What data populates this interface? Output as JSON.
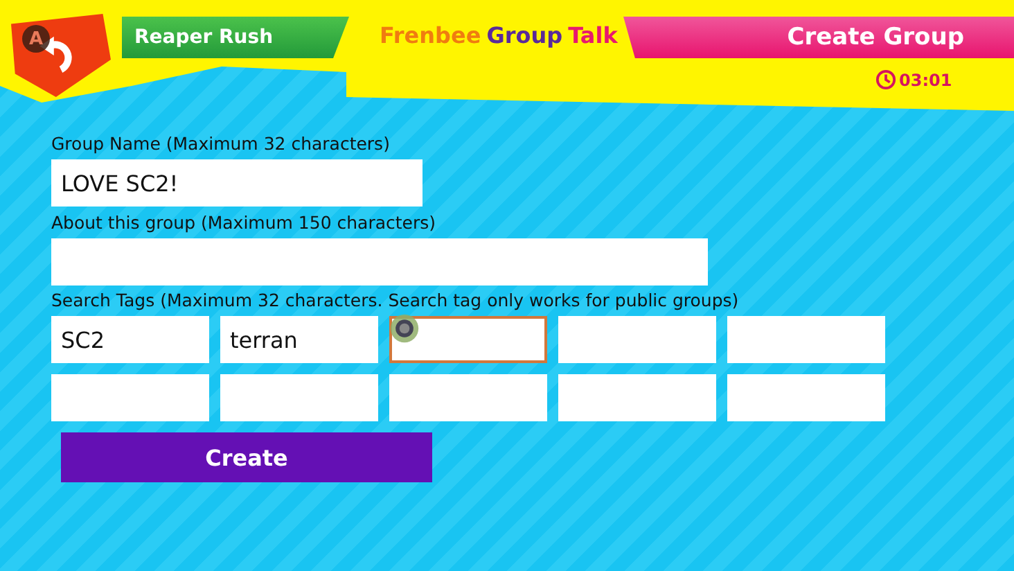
{
  "header": {
    "back_key": "A",
    "title": "Reaper Rush",
    "logo": {
      "first": "Frenbee",
      "second": "Group",
      "third": "Talk"
    },
    "screen_title": "Create Group",
    "timer": "03:01"
  },
  "form": {
    "group_name": {
      "label": "Group Name (Maximum 32 characters)",
      "value": "LOVE SC2!"
    },
    "about": {
      "label": "About this group (Maximum 150 characters)"
    },
    "tags": {
      "label": "Search Tags (Maximum 32 characters. Search tag only works for public groups)",
      "fields": [
        {
          "value": "SC2",
          "selected": false
        },
        {
          "value": "terran",
          "selected": false
        },
        {
          "selected": true
        },
        {
          "selected": false
        },
        {
          "selected": false
        },
        {
          "selected": false
        },
        {
          "selected": false
        },
        {
          "selected": false
        },
        {
          "selected": false
        },
        {
          "selected": false
        }
      ]
    },
    "submit": "Create"
  }
}
